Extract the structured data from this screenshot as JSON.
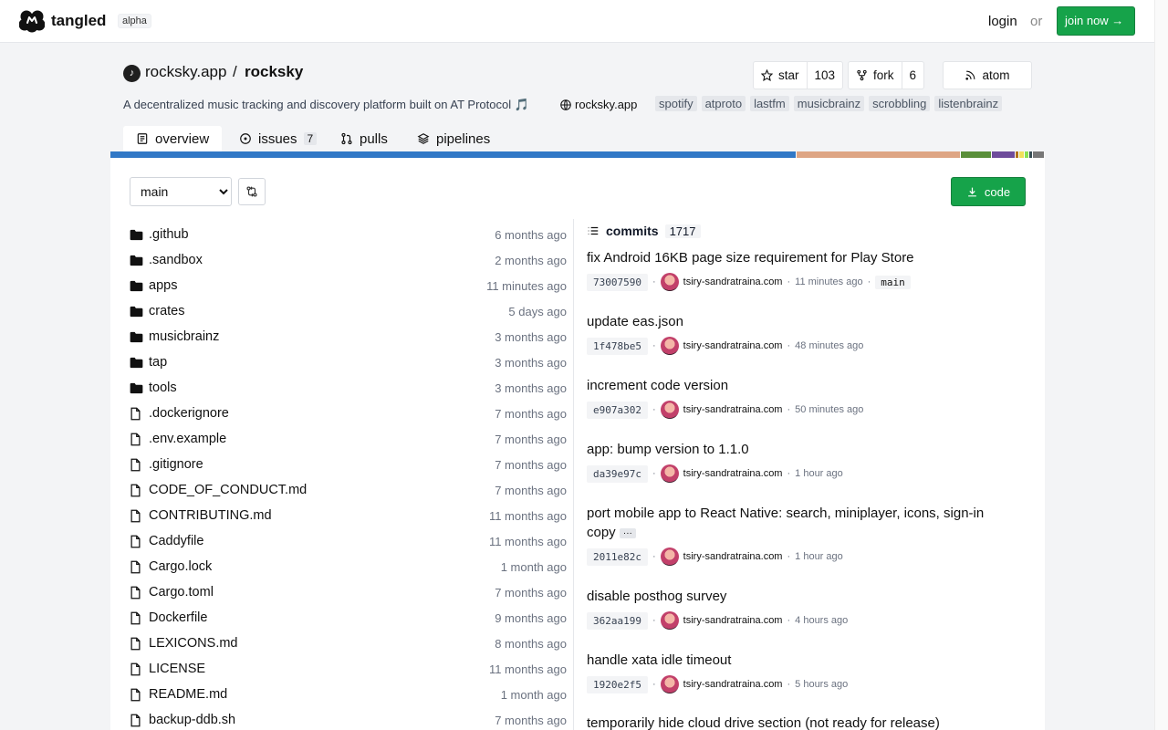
{
  "nav": {
    "brand": "tangled",
    "badge": "alpha",
    "login": "login",
    "or": "or",
    "join": "join now →"
  },
  "repo": {
    "owner": "rocksky.app",
    "slash": "/",
    "name": "rocksky",
    "description": "A decentralized music tracking and discovery platform built on AT Protocol 🎵",
    "website": "rocksky.app",
    "topics": [
      "spotify",
      "atproto",
      "lastfm",
      "musicbrainz",
      "scrobbling",
      "listenbrainz"
    ],
    "star_label": "star",
    "star_count": "103",
    "fork_label": "fork",
    "fork_count": "6",
    "atom_label": "atom"
  },
  "tabs": [
    {
      "label": "overview",
      "icon": "book-icon",
      "active": true
    },
    {
      "label": "issues",
      "icon": "circle-dot-icon",
      "badge": "7"
    },
    {
      "label": "pulls",
      "icon": "git-pull-icon"
    },
    {
      "label": "pipelines",
      "icon": "layers-icon"
    }
  ],
  "language_bar": [
    {
      "color": "#3178c6",
      "fraction": 0.734
    },
    {
      "color": "#dea584",
      "fraction": 0.176
    },
    {
      "color": "#5a8f3a",
      "fraction": 0.033
    },
    {
      "color": "#6e4c9b",
      "fraction": 0.026
    },
    {
      "color": "#b07219",
      "fraction": 0.004
    },
    {
      "color": "#f1e05a",
      "fraction": 0.006
    },
    {
      "color": "#89e051",
      "fraction": 0.004
    },
    {
      "color": "#384d54",
      "fraction": 0.004
    },
    {
      "color": "#777777",
      "fraction": 0.013
    }
  ],
  "toolbar": {
    "branch": "main",
    "code_label": "code"
  },
  "files": [
    {
      "name": ".github",
      "type": "dir",
      "time": "6 months ago"
    },
    {
      "name": ".sandbox",
      "type": "dir",
      "time": "2 months ago"
    },
    {
      "name": "apps",
      "type": "dir",
      "time": "11 minutes ago"
    },
    {
      "name": "crates",
      "type": "dir",
      "time": "5 days ago"
    },
    {
      "name": "musicbrainz",
      "type": "dir",
      "time": "3 months ago"
    },
    {
      "name": "tap",
      "type": "dir",
      "time": "3 months ago"
    },
    {
      "name": "tools",
      "type": "dir",
      "time": "3 months ago"
    },
    {
      "name": ".dockerignore",
      "type": "file",
      "time": "7 months ago"
    },
    {
      "name": ".env.example",
      "type": "file",
      "time": "7 months ago"
    },
    {
      "name": ".gitignore",
      "type": "file",
      "time": "7 months ago"
    },
    {
      "name": "CODE_OF_CONDUCT.md",
      "type": "file",
      "time": "7 months ago"
    },
    {
      "name": "CONTRIBUTING.md",
      "type": "file",
      "time": "11 months ago"
    },
    {
      "name": "Caddyfile",
      "type": "file",
      "time": "11 months ago"
    },
    {
      "name": "Cargo.lock",
      "type": "file",
      "time": "1 month ago"
    },
    {
      "name": "Cargo.toml",
      "type": "file",
      "time": "7 months ago"
    },
    {
      "name": "Dockerfile",
      "type": "file",
      "time": "9 months ago"
    },
    {
      "name": "LEXICONS.md",
      "type": "file",
      "time": "8 months ago"
    },
    {
      "name": "LICENSE",
      "type": "file",
      "time": "11 months ago"
    },
    {
      "name": "README.md",
      "type": "file",
      "time": "1 month ago"
    },
    {
      "name": "backup-ddb.sh",
      "type": "file",
      "time": "7 months ago"
    }
  ],
  "commits": {
    "title": "commits",
    "count": "1717",
    "items": [
      {
        "message": "fix Android 16KB page size requirement for Play Store",
        "sha": "73007590",
        "author": "tsiry-sandratraina.com",
        "time": "11 minutes ago",
        "branch": "main"
      },
      {
        "message": "update eas.json",
        "sha": "1f478be5",
        "author": "tsiry-sandratraina.com",
        "time": "48 minutes ago"
      },
      {
        "message": "increment code version",
        "sha": "e907a302",
        "author": "tsiry-sandratraina.com",
        "time": "50 minutes ago"
      },
      {
        "message": "app: bump version to 1.1.0",
        "sha": "da39e97c",
        "author": "tsiry-sandratraina.com",
        "time": "1 hour ago"
      },
      {
        "message": "port mobile app to React Native: search, miniplayer, icons, sign-in copy",
        "sha": "2011e82c",
        "author": "tsiry-sandratraina.com",
        "time": "1 hour ago",
        "truncated": true,
        "more": "···"
      },
      {
        "message": "disable posthog survey",
        "sha": "362aa199",
        "author": "tsiry-sandratraina.com",
        "time": "4 hours ago"
      },
      {
        "message": "handle xata idle timeout",
        "sha": "1920e2f5",
        "author": "tsiry-sandratraina.com",
        "time": "5 hours ago"
      },
      {
        "message": "temporarily hide cloud drive section (not ready for release)",
        "sha": "",
        "author": "",
        "time": ""
      }
    ]
  }
}
